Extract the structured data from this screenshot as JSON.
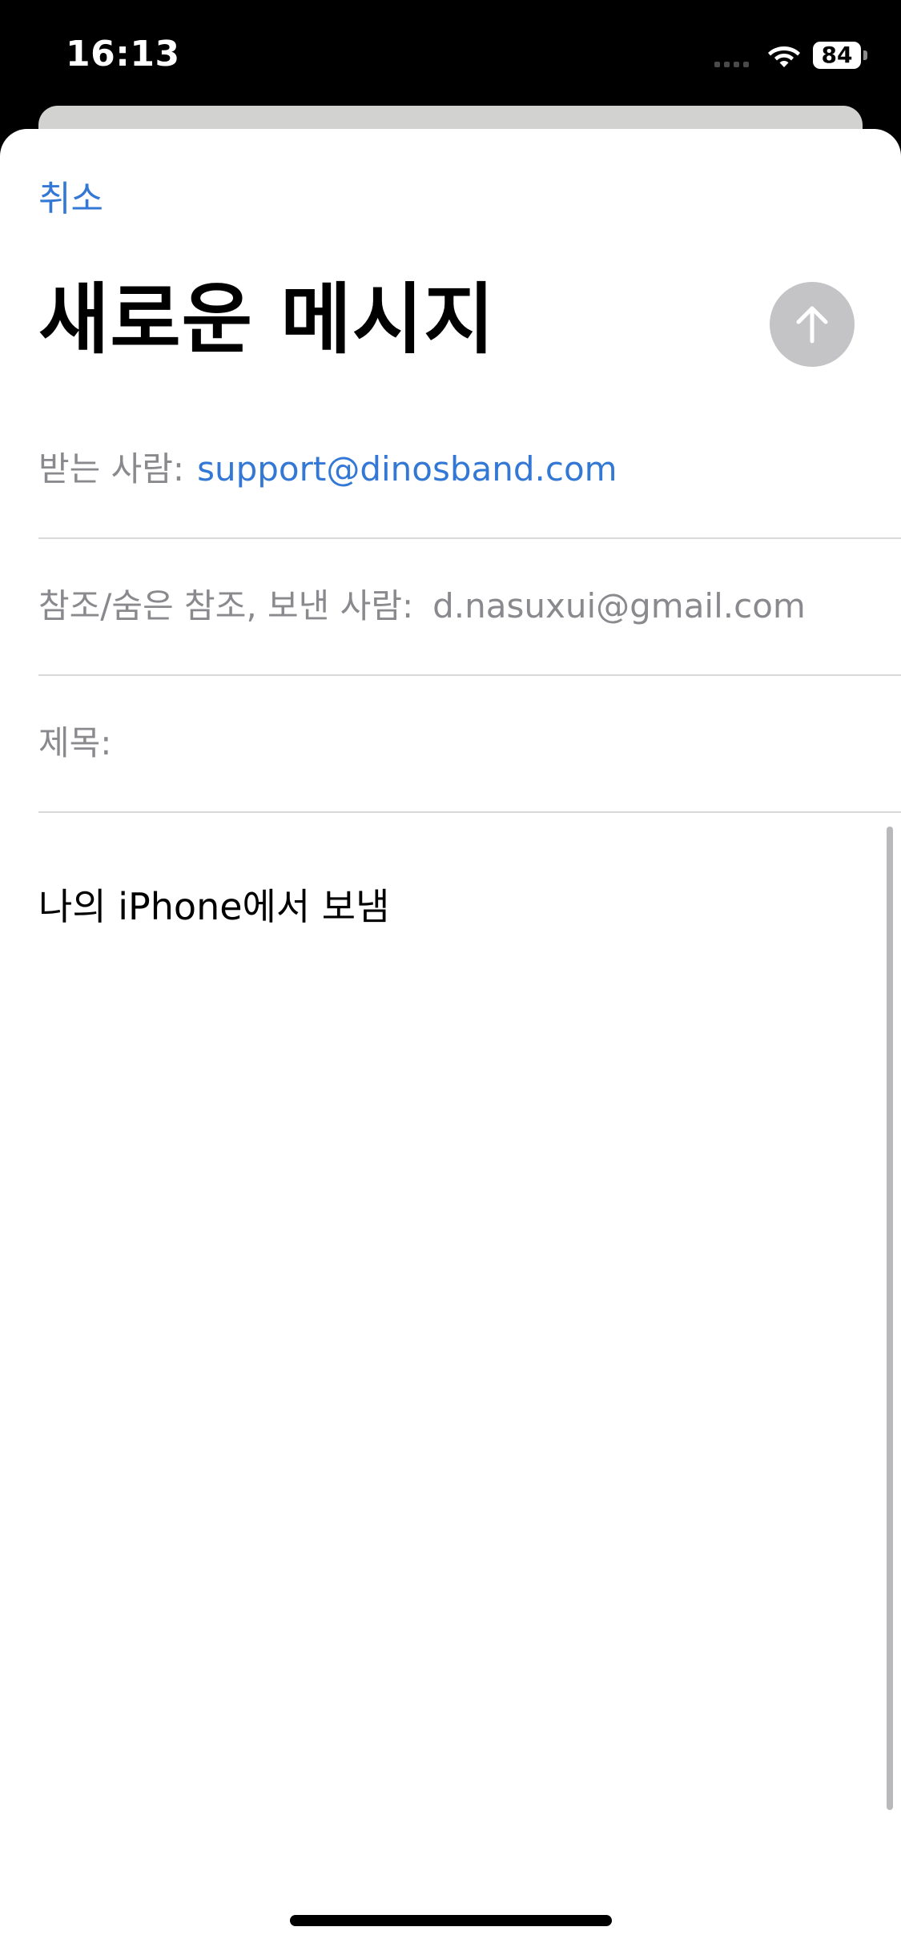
{
  "status_bar": {
    "time": "16:13",
    "battery": "84",
    "icons": [
      "cellular-signal-icon",
      "wifi-icon",
      "battery-icon"
    ]
  },
  "compose": {
    "cancel_label": "취소",
    "title": "새로운 메시지",
    "send_icon": "arrow-up-icon",
    "to_label": "받는 사람:",
    "to_value": "support@dinosband.com",
    "cc_label": "참조/숨은 참조, 보낸 사람:",
    "from_value": "d.nasuxui@gmail.com",
    "subject_label": "제목:",
    "subject_value": "",
    "signature": "나의 iPhone에서 보냄"
  },
  "colors": {
    "accent": "#3478d6",
    "label_gray": "#8a8a8e",
    "send_button_disabled": "#c4c4c6"
  }
}
